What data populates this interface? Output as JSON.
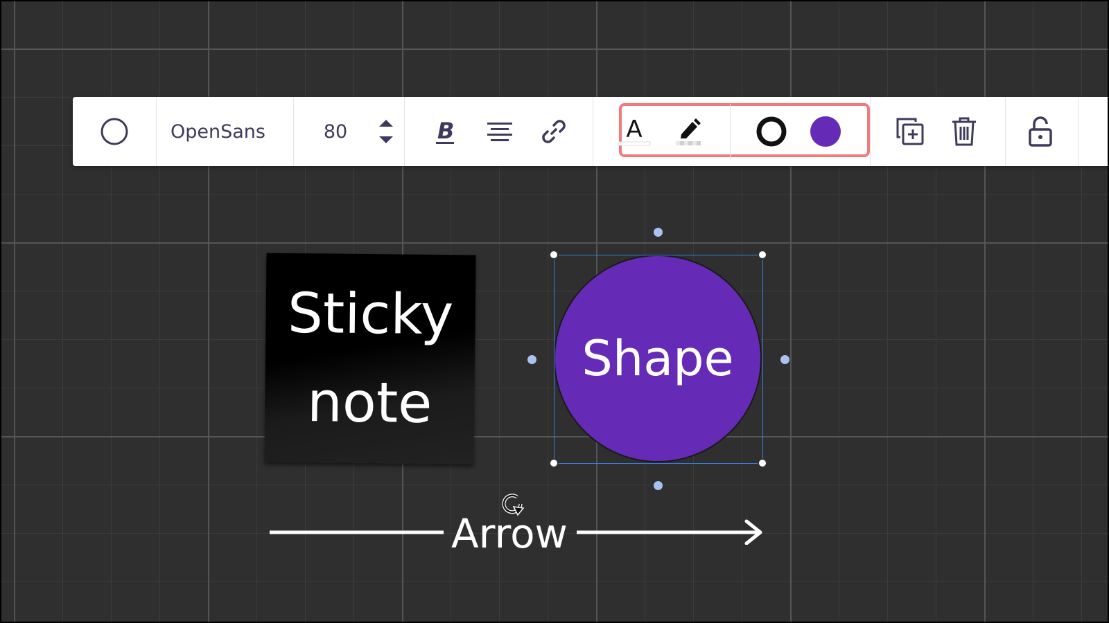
{
  "toolbar": {
    "shape_icon": "circle-outline-icon",
    "font_family": "OpenSans",
    "font_size": "80",
    "icons": {
      "stepper": "up-down-arrows-icon",
      "bold": "bold-icon",
      "align": "align-center-icon",
      "link": "link-icon",
      "text_color": "text-color-icon",
      "highlight": "highlighter-icon",
      "border": "border-color-icon",
      "fill": "fill-color-icon",
      "duplicate": "duplicate-icon",
      "delete": "trash-icon",
      "lock": "unlock-icon"
    },
    "colors": {
      "fill": "#652bb6",
      "border": "#1a1a1a",
      "highlight_box": "#f27a7c"
    }
  },
  "canvas": {
    "sticky_note": {
      "line1": "Sticky",
      "line2": "note"
    },
    "shape": {
      "label": "Shape",
      "fill": "#652bb6"
    },
    "arrow": {
      "label": "Arrow"
    }
  }
}
